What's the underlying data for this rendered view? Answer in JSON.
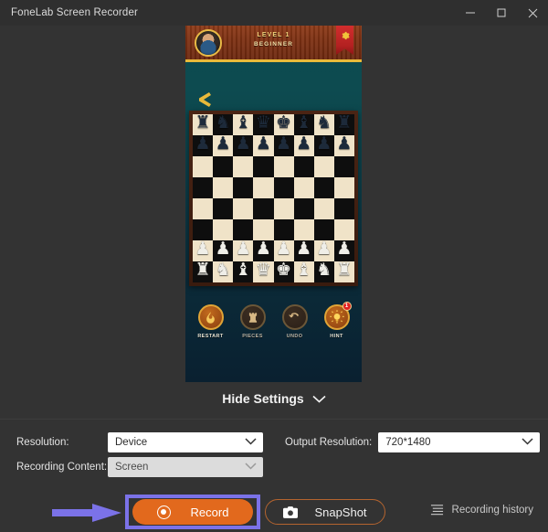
{
  "window": {
    "title": "FoneLab Screen Recorder",
    "controls": [
      {
        "name": "minimize",
        "glyph": "minimize-icon"
      },
      {
        "name": "maximize",
        "glyph": "maximize-icon"
      },
      {
        "name": "close",
        "glyph": "close-icon"
      }
    ],
    "background_color": "#333333",
    "titlebar_color": "#2f2f2f"
  },
  "preview": {
    "game": {
      "header": {
        "avatar_icon": "player-avatar",
        "level_label": "LEVEL 1",
        "rank_label": "BEGINNER",
        "settings_icon": "gear-icon",
        "banner_color": "#7e3113",
        "accent_color": "#e9b93a"
      },
      "back_icon": "chevron-left-icon",
      "board": {
        "light_square_color": "#f0e3c8",
        "dark_square_color": "#0e0e0e",
        "frame_color": "#3a1b0e",
        "rows": [
          [
            "r",
            "n",
            "b",
            "q",
            "k",
            "b",
            "n",
            "r"
          ],
          [
            "p",
            "p",
            "p",
            "p",
            "p",
            "p",
            "p",
            "p"
          ],
          [
            "",
            "",
            "",
            "",
            "",
            "",
            "",
            ""
          ],
          [
            "",
            "",
            "",
            "",
            "",
            "",
            "",
            ""
          ],
          [
            "",
            "",
            "",
            "",
            "",
            "",
            "",
            ""
          ],
          [
            "",
            "",
            "",
            "",
            "",
            "",
            "",
            ""
          ],
          [
            "P",
            "P",
            "P",
            "P",
            "P",
            "P",
            "P",
            "P"
          ],
          [
            "R",
            "N",
            "B",
            "Q",
            "K",
            "B",
            "N",
            "R"
          ]
        ]
      },
      "actions": [
        {
          "label": "RESTART",
          "icon": "flame-icon",
          "active": true,
          "badge": ""
        },
        {
          "label": "PIECES",
          "icon": "rook-icon",
          "active": false,
          "badge": ""
        },
        {
          "label": "UNDO",
          "icon": "undo-arrow-icon",
          "active": false,
          "badge": ""
        },
        {
          "label": "HINT",
          "icon": "lightbulb-icon",
          "active": true,
          "badge": "1"
        }
      ]
    }
  },
  "settings": {
    "toggle_label": "Hide Settings",
    "toggle_icon": "chevron-down-icon",
    "resolution": {
      "label": "Resolution:",
      "value": "Device",
      "icon": "chevron-down-icon",
      "disabled": false
    },
    "recording_content": {
      "label": "Recording Content:",
      "value": "Screen",
      "icon": "chevron-down-icon",
      "disabled": true
    },
    "output_resolution": {
      "label": "Output Resolution:",
      "value": "720*1480",
      "icon": "chevron-down-icon",
      "disabled": false
    }
  },
  "actions": {
    "record": {
      "label": "Record",
      "icon": "record-dot-icon",
      "color": "#e2691d",
      "highlight_color": "#7b72e8"
    },
    "snapshot": {
      "label": "SnapShot",
      "icon": "camera-icon",
      "border_color": "#b4642f"
    },
    "recording_history": {
      "label": "Recording history",
      "icon": "list-icon"
    },
    "annotation_arrow": {
      "icon": "arrow-right-annotation",
      "color": "#7b72e8"
    }
  }
}
